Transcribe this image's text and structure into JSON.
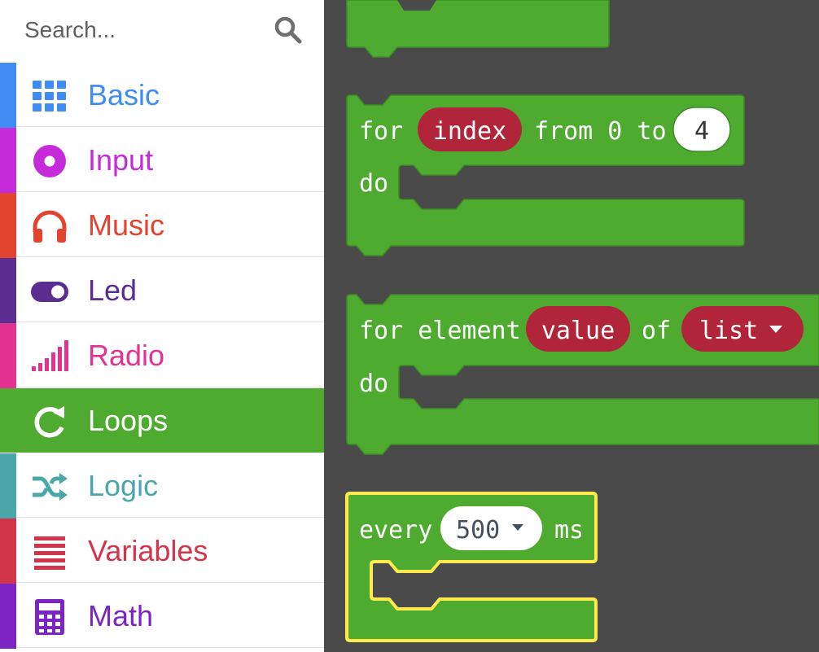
{
  "search": {
    "placeholder": "Search..."
  },
  "toolbox": {
    "categories": [
      {
        "label": "Basic",
        "color": "#3f8cf5",
        "icon": "grid-icon"
      },
      {
        "label": "Input",
        "color": "#c52bd8",
        "icon": "radio-button-icon"
      },
      {
        "label": "Music",
        "color": "#e2442f",
        "icon": "headphones-icon"
      },
      {
        "label": "Led",
        "color": "#5c2d91",
        "icon": "toggle-icon"
      },
      {
        "label": "Radio",
        "color": "#e3328f",
        "icon": "signal-bars-icon"
      },
      {
        "label": "Loops",
        "color": "#4eab2f",
        "icon": "loop-arrow-icon",
        "selected": true
      },
      {
        "label": "Logic",
        "color": "#4aa8a8",
        "icon": "shuffle-icon"
      },
      {
        "label": "Variables",
        "color": "#d2354a",
        "icon": "lines-icon"
      },
      {
        "label": "Math",
        "color": "#7d24c5",
        "icon": "calculator-icon"
      }
    ]
  },
  "blocks": {
    "for_index": {
      "kw_for": "for",
      "var": "index",
      "kw_from": "from 0 to",
      "to_value": "4",
      "kw_do": "do"
    },
    "for_element": {
      "kw_for": "for element",
      "var": "value",
      "kw_of": "of",
      "list_var": "list",
      "kw_do": "do"
    },
    "every": {
      "kw_every": "every",
      "interval": "500",
      "kw_ms": "ms"
    }
  },
  "colors": {
    "loops_block": "#4eab2f",
    "block_stroke": "#3e8b26",
    "variable_pill": "#b1253b",
    "workspace_bg": "#4a4a4a",
    "selected_outline": "#ffe94d"
  }
}
